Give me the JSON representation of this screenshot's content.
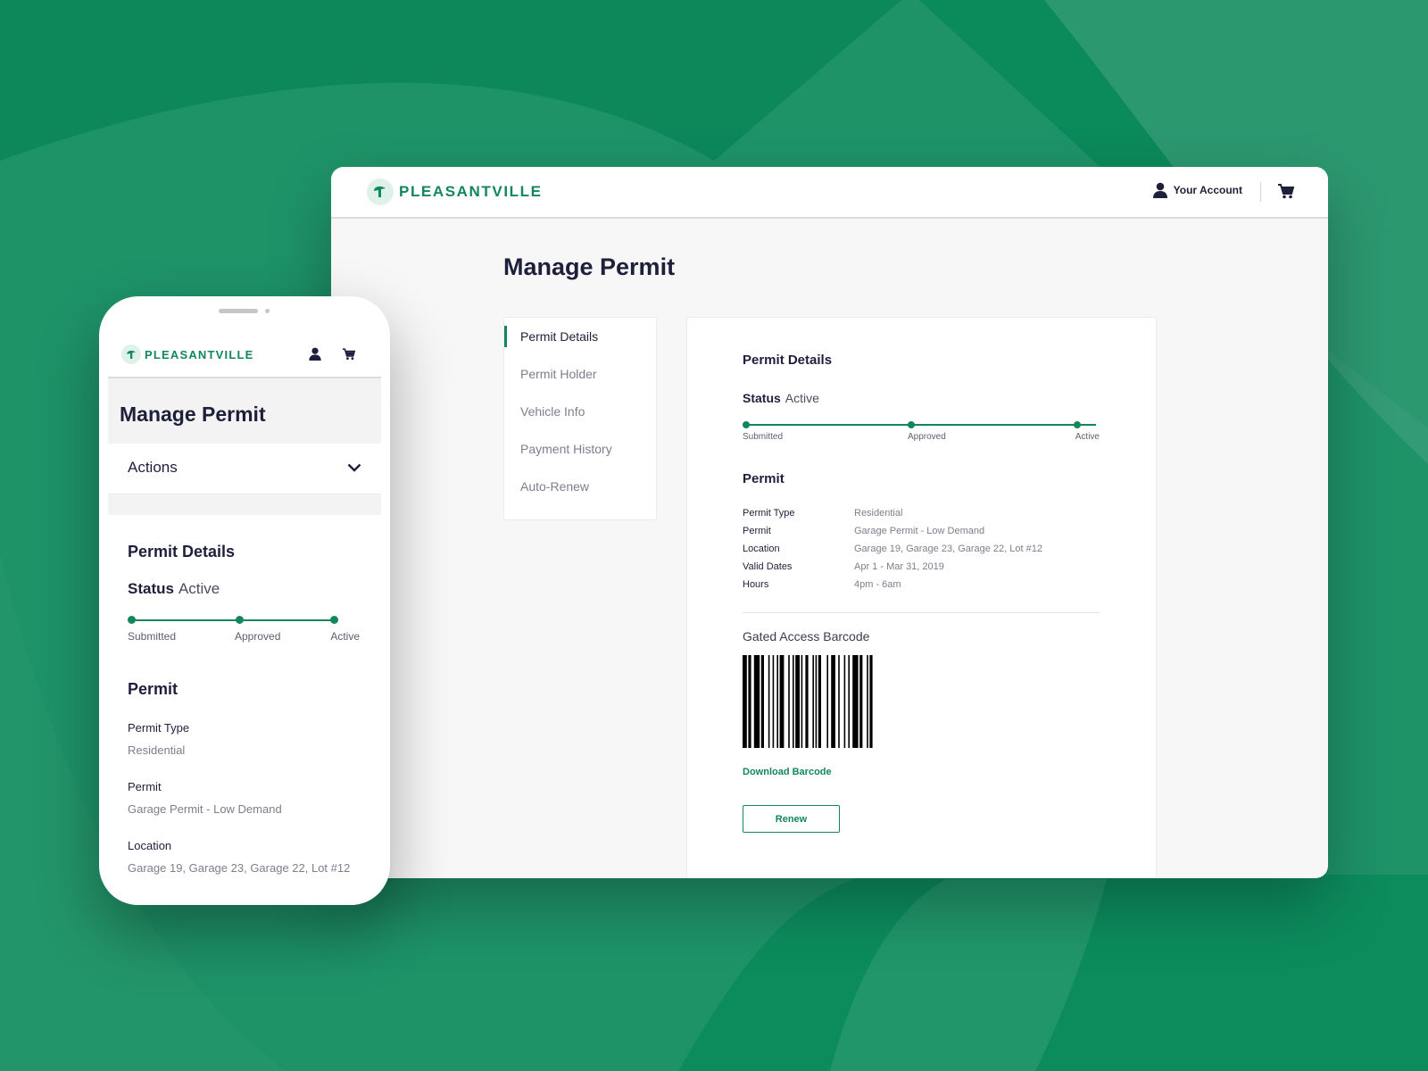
{
  "brand": {
    "name": "PLEASANTVILLE",
    "color": "#11875a"
  },
  "desktop": {
    "header": {
      "account_label": "Your Account"
    },
    "page_title": "Manage Permit",
    "side_nav": [
      {
        "label": "Permit Details",
        "active": true
      },
      {
        "label": "Permit Holder",
        "active": false
      },
      {
        "label": "Vehicle Info",
        "active": false
      },
      {
        "label": "Payment History",
        "active": false
      },
      {
        "label": "Auto-Renew",
        "active": false
      }
    ]
  },
  "permit_details": {
    "heading": "Permit Details",
    "status_label": "Status",
    "status_value": "Active",
    "steps": [
      "Submitted",
      "Approved",
      "Active"
    ],
    "permit_heading": "Permit",
    "fields": [
      {
        "label": "Permit Type",
        "value": "Residential"
      },
      {
        "label": "Permit",
        "value": "Garage Permit - Low Demand"
      },
      {
        "label": "Location",
        "value": "Garage 19, Garage 23, Garage 22, Lot #12"
      },
      {
        "label": "Valid Dates",
        "value": "Apr 1 - Mar 31, 2019"
      },
      {
        "label": "Hours",
        "value": "4pm - 6am"
      }
    ],
    "barcode_label": "Gated Access Barcode",
    "download_label": "Download Barcode",
    "renew_label": "Renew"
  },
  "mobile": {
    "page_title": "Manage Permit",
    "actions_label": "Actions"
  },
  "icons": {
    "logo": "pleasantville-logo-icon",
    "account": "user-icon",
    "cart": "cart-icon",
    "dropdown": "chevron-down-icon"
  }
}
